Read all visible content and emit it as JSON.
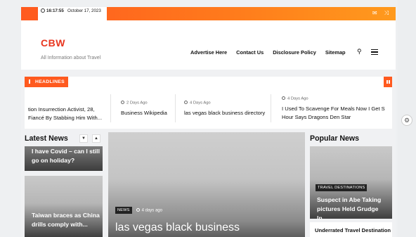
{
  "topbar": {
    "time": "16:17:55",
    "date": "October 17, 2023",
    "icons": [
      "mail-icon",
      "shuffle-icon"
    ]
  },
  "header": {
    "logo": "CBW",
    "tagline": "All Information about Travel",
    "nav": [
      "Advertise Here",
      "Contact Us",
      "Disclosure Policy",
      "Sitemap"
    ]
  },
  "ticker": {
    "label": "HEADLINES",
    "items": [
      {
        "ago": "",
        "title": "tion Insurrection Activist, 28, Fiancé By Stabbing Him With..."
      },
      {
        "ago": "2 Days Ago",
        "title": "Business Wikipedia"
      },
      {
        "ago": "4 Days Ago",
        "title": "las vegas black business directory"
      },
      {
        "ago": "4 Days Ago",
        "title": "I Used To Scavenge For Meals Now I Get S Hour Says Dragons Den Star"
      }
    ]
  },
  "latest": {
    "title": "Latest News",
    "cards": [
      {
        "title": "I have Covid – can I still go on holiday?"
      },
      {
        "title": "Taiwan braces as China drills comply with..."
      }
    ]
  },
  "featured": {
    "badge": "NEWS",
    "ago": "4 days ago",
    "title": "las vegas black business"
  },
  "popular": {
    "title": "Popular News",
    "card": {
      "badge": "TRAVEL DESTINATIONS",
      "title": "Suspect in Abe Taking pictures Held Grudge In..."
    },
    "next": "Underrated Travel Destination"
  }
}
